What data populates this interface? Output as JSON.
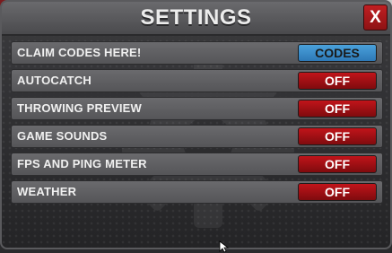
{
  "title": "SETTINGS",
  "close_label": "X",
  "settings": [
    {
      "label": "CLAIM CODES HERE!",
      "button": "CODES",
      "style": "codes"
    },
    {
      "label": "AUTOCATCH",
      "button": "OFF",
      "style": "off"
    },
    {
      "label": "THROWING PREVIEW",
      "button": "OFF",
      "style": "off"
    },
    {
      "label": "GAME SOUNDS",
      "button": "OFF",
      "style": "off"
    },
    {
      "label": "FPS AND PING METER",
      "button": "OFF",
      "style": "off"
    },
    {
      "label": "WEATHER",
      "button": "OFF",
      "style": "off"
    }
  ],
  "colors": {
    "off": "#b0121a",
    "codes": "#3d8fd0",
    "header": "#58585b",
    "close": "#b01b1e"
  }
}
